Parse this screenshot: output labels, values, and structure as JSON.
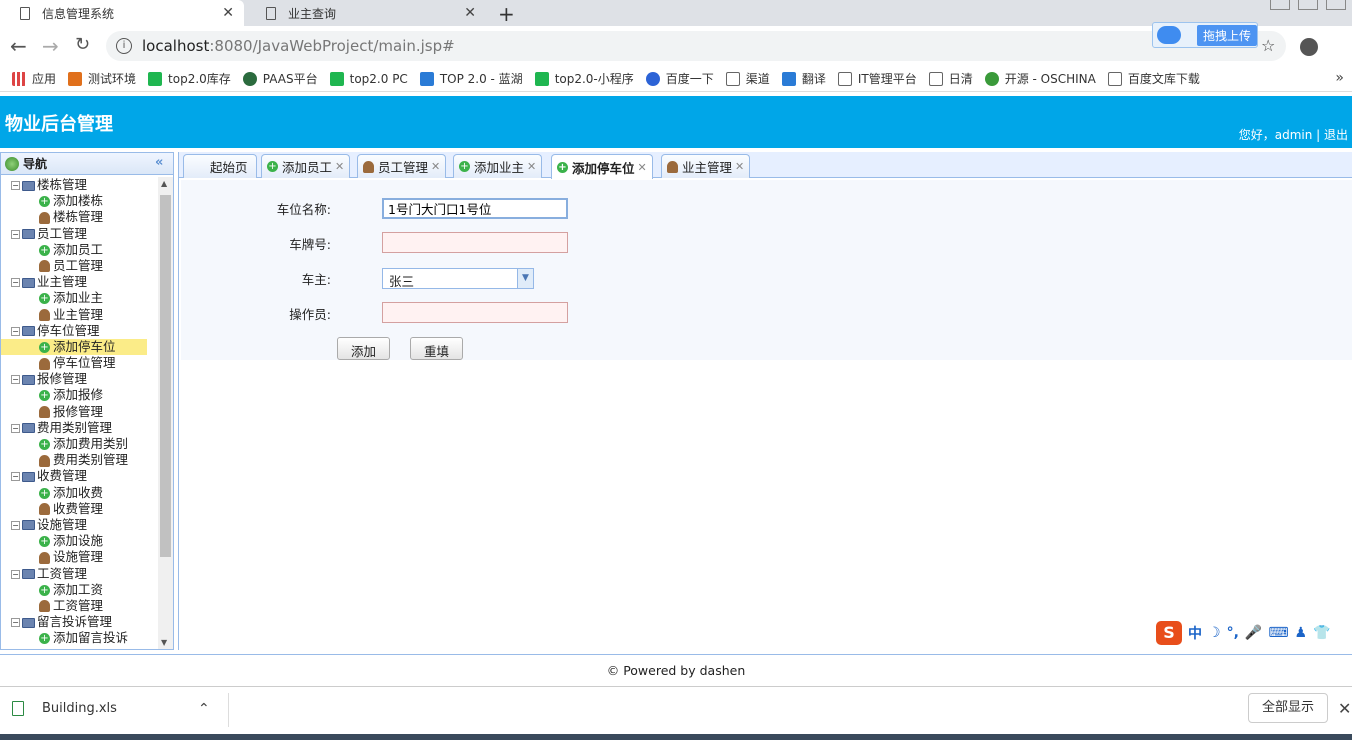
{
  "browser": {
    "tabs": [
      {
        "title": "信息管理系统",
        "active": true
      },
      {
        "title": "业主查询",
        "active": false
      }
    ],
    "url_host": "localhost",
    "url_rest": ":8080/JavaWebProject/main.jsp#",
    "upload_label": "拖拽上传",
    "bookmarks": [
      "应用",
      "测试环境",
      "top2.0库存",
      "PAAS平台",
      "top2.0 PC",
      "TOP 2.0 - 蓝湖",
      "top2.0-小程序",
      "百度一下",
      "渠道",
      "翻译",
      "IT管理平台",
      "日清",
      "开源 - OSCHINA",
      "百度文库下载"
    ]
  },
  "app": {
    "title": "物业后台管理",
    "user_text": "您好，admin | 退出"
  },
  "sidebar": {
    "title": "导航",
    "groups": [
      {
        "label": "楼栋管理",
        "items": [
          "添加楼栋",
          "楼栋管理"
        ]
      },
      {
        "label": "员工管理",
        "items": [
          "添加员工",
          "员工管理"
        ]
      },
      {
        "label": "业主管理",
        "items": [
          "添加业主",
          "业主管理"
        ]
      },
      {
        "label": "停车位管理",
        "items": [
          "添加停车位",
          "停车位管理"
        ]
      },
      {
        "label": "报修管理",
        "items": [
          "添加报修",
          "报修管理"
        ]
      },
      {
        "label": "费用类别管理",
        "items": [
          "添加费用类别",
          "费用类别管理"
        ]
      },
      {
        "label": "收费管理",
        "items": [
          "添加收费",
          "收费管理"
        ]
      },
      {
        "label": "设施管理",
        "items": [
          "添加设施",
          "设施管理"
        ]
      },
      {
        "label": "工资管理",
        "items": [
          "添加工资",
          "工资管理"
        ]
      },
      {
        "label": "留言投诉管理",
        "items": [
          "添加留言投诉"
        ]
      }
    ]
  },
  "page_tabs": [
    "起始页",
    "添加员工",
    "员工管理",
    "添加业主",
    "添加停车位",
    "业主管理"
  ],
  "form": {
    "name_label": "车位名称:",
    "name_value": "1号门大门口1号位",
    "plate_label": "车牌号:",
    "plate_value": "",
    "owner_label": "车主:",
    "owner_value": "张三",
    "operator_label": "操作员:",
    "operator_value": "",
    "add_button": "添加",
    "reset_button": "重填"
  },
  "footer": "© Powered by dashen",
  "downloads": {
    "file": "Building.xls",
    "show_all": "全部显示"
  }
}
